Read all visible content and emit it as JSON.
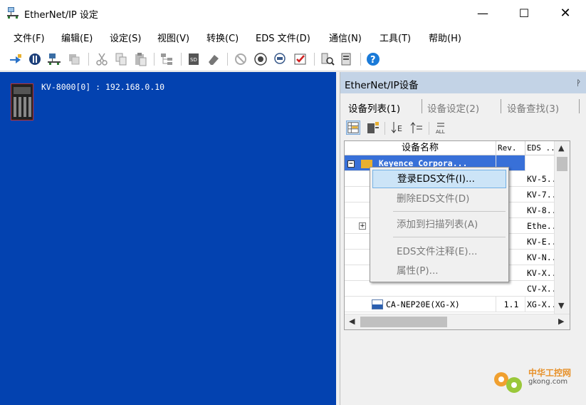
{
  "window": {
    "title": "EtherNet/IP 设定",
    "minimize": "—",
    "maximize": "☐",
    "close": "✕"
  },
  "menu": [
    "文件(F)",
    "编辑(E)",
    "设定(S)",
    "视图(V)",
    "转换(C)",
    "EDS 文件(D)",
    "通信(N)",
    "工具(T)",
    "帮助(H)"
  ],
  "canvas": {
    "plc_label": "KV-8000[0] : 192.168.0.10",
    "background": "#0342b0"
  },
  "panel": {
    "title": "EtherNet/IP设备",
    "pin": "ᚹ",
    "tabs": [
      "设备列表(1)",
      "设备设定(2)",
      "设备查找(3)"
    ],
    "columns": [
      "设备名称",
      "Rev.",
      "EDS ..."
    ],
    "rows": [
      {
        "name": "Keyence Corpora...",
        "rev": "",
        "eds": "",
        "selected": true
      },
      {
        "name": "",
        "rev": "",
        "eds": "KV-5..."
      },
      {
        "name": "",
        "rev": "",
        "eds": "KV-7..."
      },
      {
        "name": "",
        "rev": "",
        "eds": "KV-8..."
      },
      {
        "name": "",
        "rev": "",
        "eds": "Ethe..."
      },
      {
        "name": "",
        "rev": "",
        "eds": "KV-E..."
      },
      {
        "name": "",
        "rev": "",
        "eds": "KV-N..."
      },
      {
        "name": "",
        "rev": "",
        "eds": "KV-X..."
      },
      {
        "name": "",
        "rev": "",
        "eds": "CV-X..."
      },
      {
        "name": "CA-NEP20E(XG-X)",
        "rev": "1.1",
        "eds": "XG-X..."
      }
    ]
  },
  "context_menu": [
    {
      "label": "登录EDS文件(I)...",
      "state": "hover"
    },
    {
      "label": "删除EDS文件(D)",
      "state": "disabled"
    },
    {
      "label": "添加到扫描列表(A)",
      "state": "disabled"
    },
    {
      "label": "EDS文件注释(E)...",
      "state": "disabled"
    },
    {
      "label": "属性(P)...",
      "state": "disabled"
    }
  ],
  "watermark": {
    "line1": "中华工控网",
    "line2": "gkong.com"
  },
  "colors": {
    "selection": "#3870d8",
    "menu_hover": "#cce4f7",
    "panel_header": "#c3d3e6",
    "help": "#1a7ad8"
  }
}
